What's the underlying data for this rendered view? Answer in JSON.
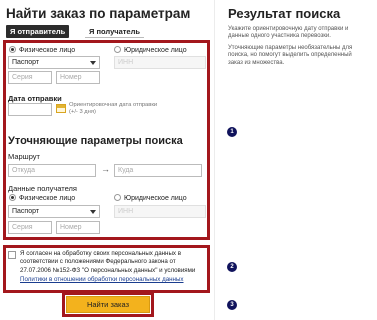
{
  "page": {
    "title": "Найти заказ по параметрам",
    "tabs": [
      {
        "label": "Я отправитель",
        "active": true
      },
      {
        "label": "Я получатель",
        "active": false
      }
    ]
  },
  "sender": {
    "type_options": [
      "Физическое лицо",
      "Юридическое лицо"
    ],
    "selected_type": "Физическое лицо",
    "doc_type": "Паспорт",
    "inn_placeholder": "ИНН",
    "series_placeholder": "Серия",
    "number_placeholder": "Номер"
  },
  "dispatch": {
    "label": "Дата отправки",
    "hint": "Ориентировочная дата отправки\n(+/- 3 дня)"
  },
  "refine": {
    "title": "Уточняющие параметры поиска",
    "route_label": "Маршрут",
    "from_placeholder": "Откуда",
    "to_placeholder": "Куда",
    "arrow": "→",
    "receiver_label": "Данные получателя",
    "type_options": [
      "Физическое лицо",
      "Юридическое лицо"
    ],
    "selected_type": "Физическое лицо",
    "doc_type": "Паспорт",
    "inn_placeholder": "ИНН",
    "series_placeholder": "Серия",
    "number_placeholder": "Номер"
  },
  "consent": {
    "text": "Я согласен на обработку своих персональных данных в соответствии с положениями Федерального закона от 27.07.2006 №152-ФЗ \"О персональных данных\" и условиями",
    "link": "Политики в отношении обработки персональных данных"
  },
  "submit_label": "Найти заказ",
  "result": {
    "title": "Результат поиска",
    "text1": "Укажите ориентировочную дату отправки и данные одного участника перевозки.",
    "text2": "Уточняющие параметры необязательны для поиска, но помогут выделить определенный заказ из множества."
  },
  "badges": [
    "1",
    "2",
    "3"
  ],
  "colors": {
    "highlight_frame": "#a3171d",
    "button": "#f3b21d",
    "badge": "#10135c",
    "link": "#1a3d8f"
  }
}
